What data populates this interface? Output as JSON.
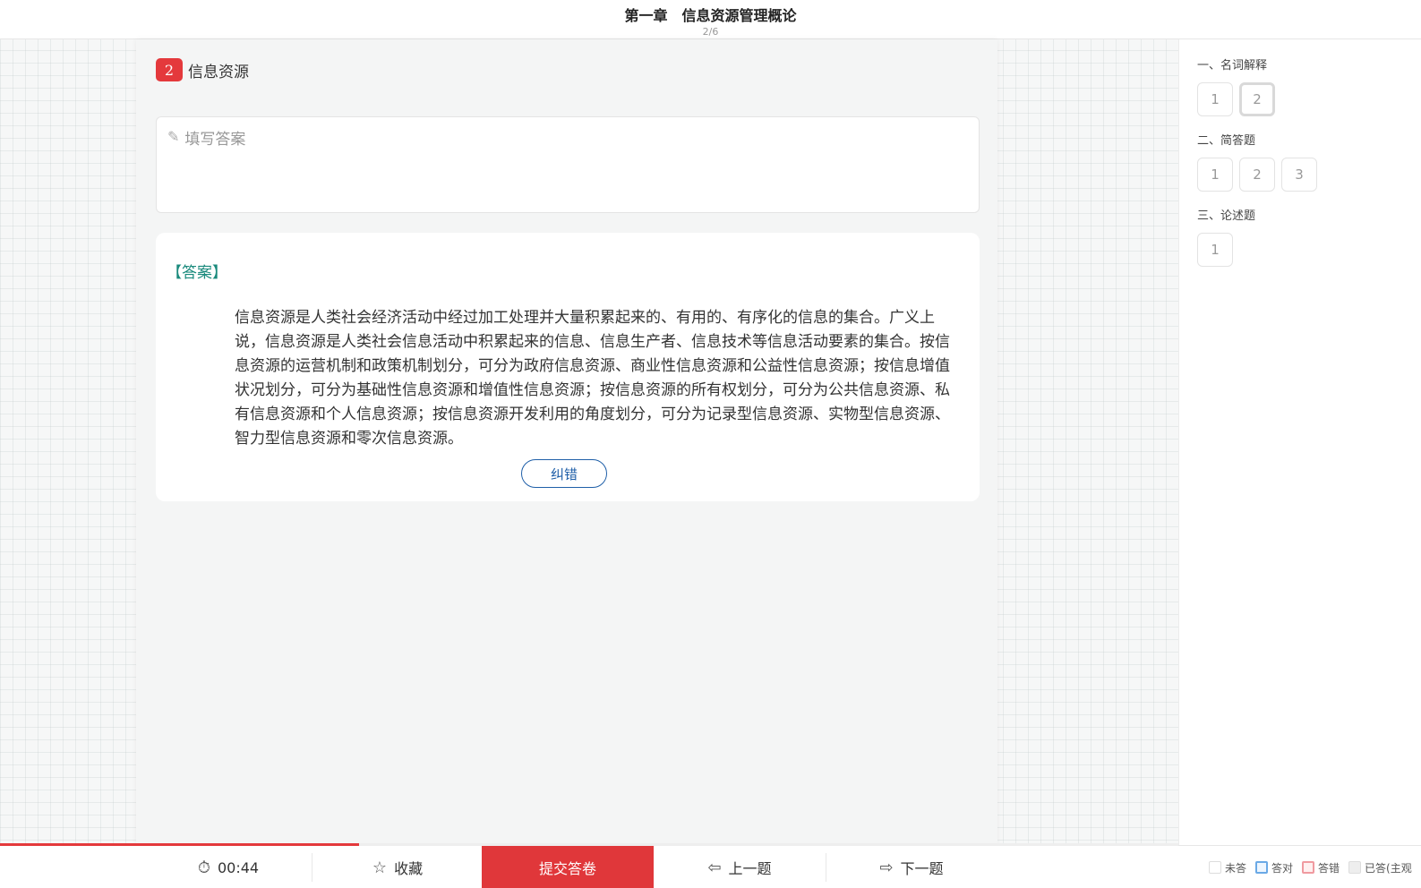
{
  "header": {
    "title": "第一章　信息资源管理概论",
    "counter": "2/6"
  },
  "question": {
    "number": "2",
    "title": "信息资源",
    "input_placeholder": "填写答案",
    "answer_label": "【答案】",
    "answer_text": "信息资源是人类社会经济活动中经过加工处理并大量积累起来的、有用的、有序化的信息的集合。广义上说，信息资源是人类社会信息活动中积累起来的信息、信息生产者、信息技术等信息活动要素的集合。按信息资源的运营机制和政策机制划分，可分为政府信息资源、商业性信息资源和公益性信息资源；按信息增值状况划分，可分为基础性信息资源和增值性信息资源；按信息资源的所有权划分，可分为公共信息资源、私有信息资源和个人信息资源；按信息资源开发利用的角度划分，可分为记录型信息资源、实物型信息资源、智力型信息资源和零次信息资源。",
    "correct_button": "纠错"
  },
  "sidebar": {
    "sections": [
      {
        "title": "一、名词解释",
        "items": [
          "1",
          "2"
        ]
      },
      {
        "title": "二、简答题",
        "items": [
          "1",
          "2",
          "3"
        ]
      },
      {
        "title": "三、论述题",
        "items": [
          "1"
        ]
      }
    ]
  },
  "bottom": {
    "progress": 0.305,
    "timer": "00:44",
    "favorite": "收藏",
    "submit": "提交答卷",
    "prev": "上一题",
    "next": "下一题"
  },
  "legend": {
    "unanswered": "未答",
    "correct": "答对",
    "wrong": "答错",
    "answered_subjective": "已答(主观"
  },
  "colors": {
    "accent": "#e4393c",
    "answer_label": "#1a8a7c",
    "link": "#1f5fa8"
  }
}
